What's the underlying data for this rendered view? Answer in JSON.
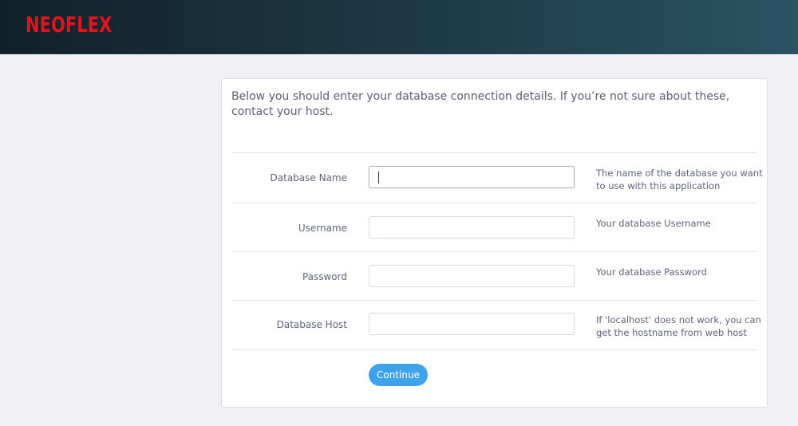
{
  "header": {
    "logo_text": "NEOFLEX"
  },
  "form": {
    "intro": "Below you should enter your database connection details. If you’re not sure about these, contact your host.",
    "fields": [
      {
        "label": "Database Name",
        "value": "",
        "placeholder": "",
        "help": "The name of the database you want to use with this application"
      },
      {
        "label": "Username",
        "value": "",
        "placeholder": "",
        "help": "Your database Username"
      },
      {
        "label": "Password",
        "value": "",
        "placeholder": "",
        "help": "Your database Password"
      },
      {
        "label": "Database Host",
        "value": "",
        "placeholder": "",
        "help": "If 'localhost' does not work, you can get the hostname from web host"
      }
    ],
    "submit_label": "Continue"
  },
  "colors": {
    "header_dark": "#11212b",
    "header_light": "#2c5263",
    "logo": "#e4141b",
    "button": "#3fa3ec",
    "page_background": "#f1f1f5"
  }
}
